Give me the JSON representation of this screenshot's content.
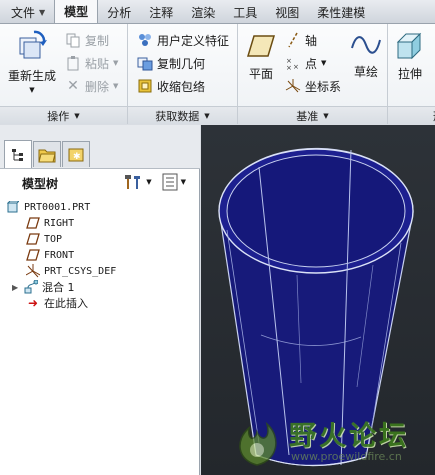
{
  "tabs": [
    {
      "label": "文件",
      "has_arrow": true
    },
    {
      "label": "模型"
    },
    {
      "label": "分析"
    },
    {
      "label": "注释"
    },
    {
      "label": "渲染"
    },
    {
      "label": "工具"
    },
    {
      "label": "视图"
    },
    {
      "label": "柔性建模"
    }
  ],
  "ribbon": {
    "operations": {
      "label": "操作",
      "regenerate": "重新生成",
      "copy": "复制",
      "paste": "粘贴",
      "delete": "删除"
    },
    "get_data": {
      "label": "获取数据",
      "udf": "用户定义特征",
      "copy_geometry": "复制几何",
      "shrinkwrap": "收缩包络"
    },
    "datum": {
      "label": "基准",
      "plane": "平面",
      "axis": "轴",
      "point": "点",
      "csys": "坐标系",
      "sketch": "草绘"
    },
    "shapes": {
      "extrude": "拉伸"
    }
  },
  "panel": {
    "title": "模型树",
    "tree": [
      {
        "label": "PRT0001.PRT",
        "icon": "part-icon"
      },
      {
        "label": "RIGHT",
        "icon": "datum-plane-icon"
      },
      {
        "label": "TOP",
        "icon": "datum-plane-icon"
      },
      {
        "label": "FRONT",
        "icon": "datum-plane-icon"
      },
      {
        "label": "PRT_CSYS_DEF",
        "icon": "csys-icon"
      },
      {
        "label": "混合 1",
        "icon": "blend-icon"
      },
      {
        "label": "在此插入",
        "icon": "insert-here-arrow-icon"
      }
    ]
  },
  "watermark": {
    "text": "野火论坛",
    "url": "www.proewildfire.cn"
  },
  "colors": {
    "model_fill": "#171a7a",
    "model_edge": "#c9d2f0",
    "viewport_bg": "#2a2e33",
    "accent_blue": "#1f5fbf",
    "insert_arrow": "#cc1111"
  }
}
